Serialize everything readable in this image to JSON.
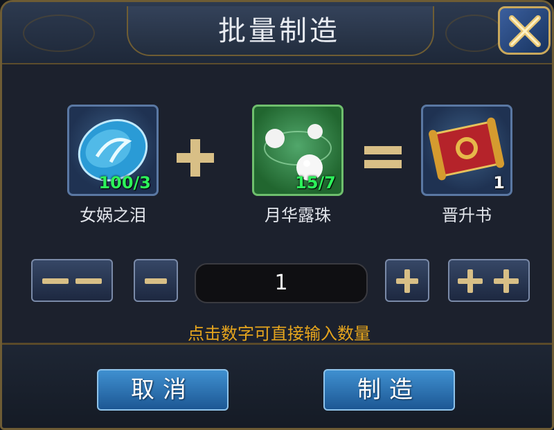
{
  "dialog": {
    "title": "批量制造",
    "close_icon": "close-x-icon"
  },
  "recipe": {
    "ingredients": [
      {
        "name": "女娲之泪",
        "count": "100/3",
        "icon": "blue-tear-gem-icon"
      },
      {
        "name": "月华露珠",
        "count": "15/7",
        "icon": "pearl-dew-icon"
      }
    ],
    "result": {
      "name": "晋升书",
      "count": "1",
      "icon": "scroll-book-icon"
    },
    "plus_icon": "plus-operator-icon",
    "equals_icon": "equals-operator-icon"
  },
  "quantity": {
    "value": "1",
    "minus_many_icon": "double-minus-icon",
    "minus_one_icon": "minus-icon",
    "plus_one_icon": "plus-icon",
    "plus_many_icon": "double-plus-icon",
    "hint": "点击数字可直接输入数量"
  },
  "buttons": {
    "cancel_label": "取消",
    "craft_label": "制造"
  },
  "colors": {
    "accent_gold": "#d8bf86",
    "count_green": "#2cf35a",
    "hint_orange": "#e6a51d",
    "button_blue": "#2f78b8"
  }
}
